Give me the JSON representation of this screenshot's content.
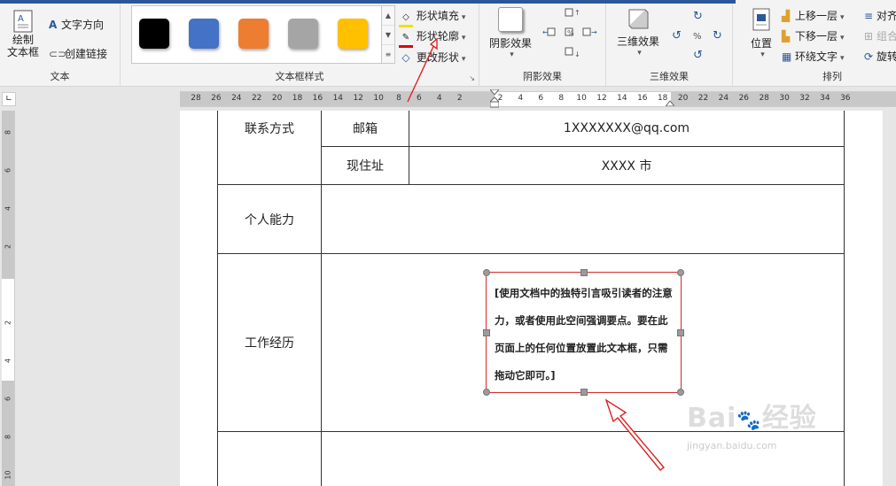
{
  "ribbon": {
    "groups": {
      "text": {
        "label": "文本",
        "draw_textbox": "绘制\n文本框",
        "text_direction": "文字方向",
        "create_link": "创建链接"
      },
      "textbox_styles": {
        "label": "文本框样式",
        "swatches": [
          "#000000",
          "#4472c4",
          "#ed7d31",
          "#a5a5a5",
          "#ffc000"
        ],
        "shape_fill": "形状填充",
        "shape_outline": "形状轮廓",
        "change_shape": "更改形状"
      },
      "shadow": {
        "label": "阴影效果",
        "button": "阴影效果"
      },
      "threed": {
        "label": "三维效果",
        "button": "三维效果"
      },
      "arrange": {
        "label": "排列",
        "position": "位置",
        "bring_forward": "上移一层",
        "send_backward": "下移一层",
        "wrap_text": "环绕文字",
        "align": "对齐",
        "group": "组合",
        "rotate": "旋转"
      }
    }
  },
  "ruler": {
    "horizontal_labels": [
      "28",
      "26",
      "24",
      "22",
      "20",
      "18",
      "16",
      "14",
      "12",
      "10",
      "8",
      "6",
      "4",
      "2",
      "",
      "2",
      "4",
      "6",
      "8",
      "10",
      "12",
      "14",
      "16",
      "18",
      "20",
      "22",
      "24",
      "26",
      "28",
      "30",
      "32",
      "34",
      "36"
    ],
    "vertical_labels": [
      "8",
      "6",
      "4",
      "2",
      "",
      "2",
      "4",
      "6",
      "8",
      "10"
    ]
  },
  "table": {
    "contact_label": "联系方式",
    "email_label": "邮箱",
    "email_value": "1XXXXXXX@qq.com",
    "address_label": "现住址",
    "address_value": "XXXX 市",
    "ability_label": "个人能力",
    "experience_label": "工作经历"
  },
  "textbox": {
    "content": "[使用文档中的独特引言吸引读者的注意力，或者使用此空间强调要点。要在此页面上的任何位置放置此文本框，只需拖动它即可。]"
  },
  "watermark": {
    "brand": "Bai",
    "brand2": "经验",
    "url": "jingyan.baidu.com"
  }
}
